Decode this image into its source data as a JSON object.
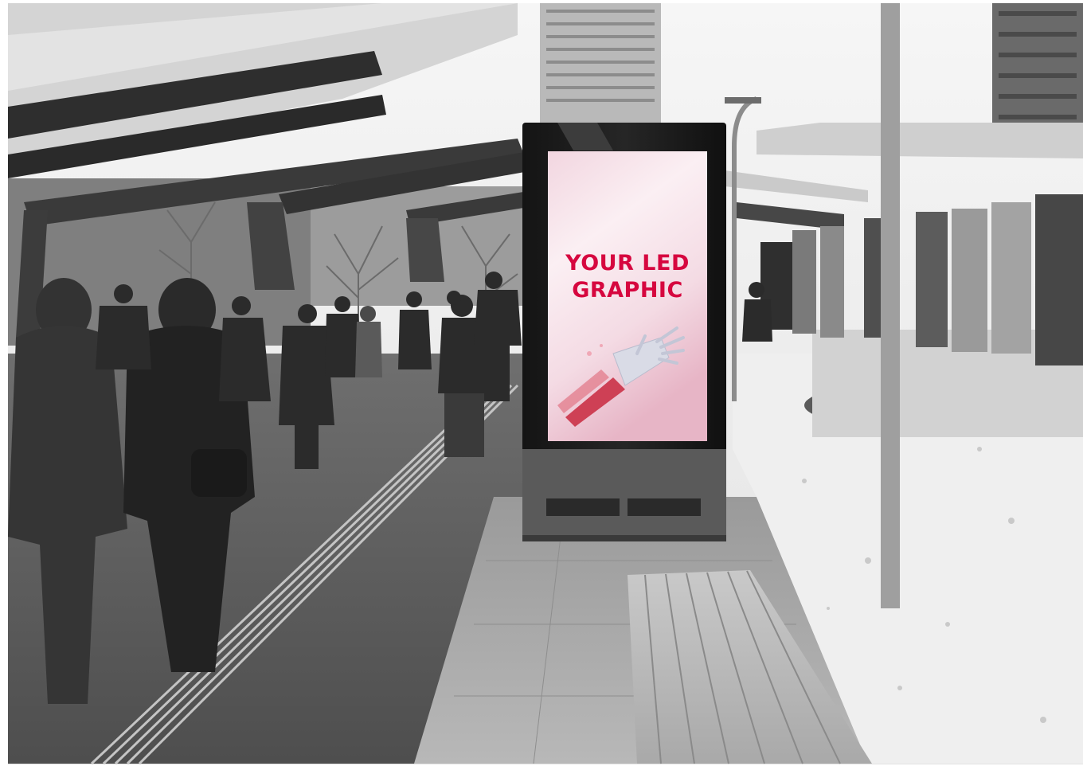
{
  "scene": {
    "description_tags": [
      "black-and-white street scene",
      "digital totem kiosk",
      "winter"
    ],
    "palette": {
      "sky": "#f1f1f1",
      "structure_dark": "#3a3a3a",
      "pavement": "#8a8a8a",
      "snow": "#eeeeee",
      "totem_body": "#1e1e1e",
      "screen_pink_light": "#f8e8ee",
      "screen_pink": "#eec7d4",
      "accent_red": "#d6073f"
    }
  },
  "led_screen": {
    "line1": "YOUR LED",
    "line2": "GRAPHIC",
    "graphic_icon": "robotic-hand-icon"
  }
}
